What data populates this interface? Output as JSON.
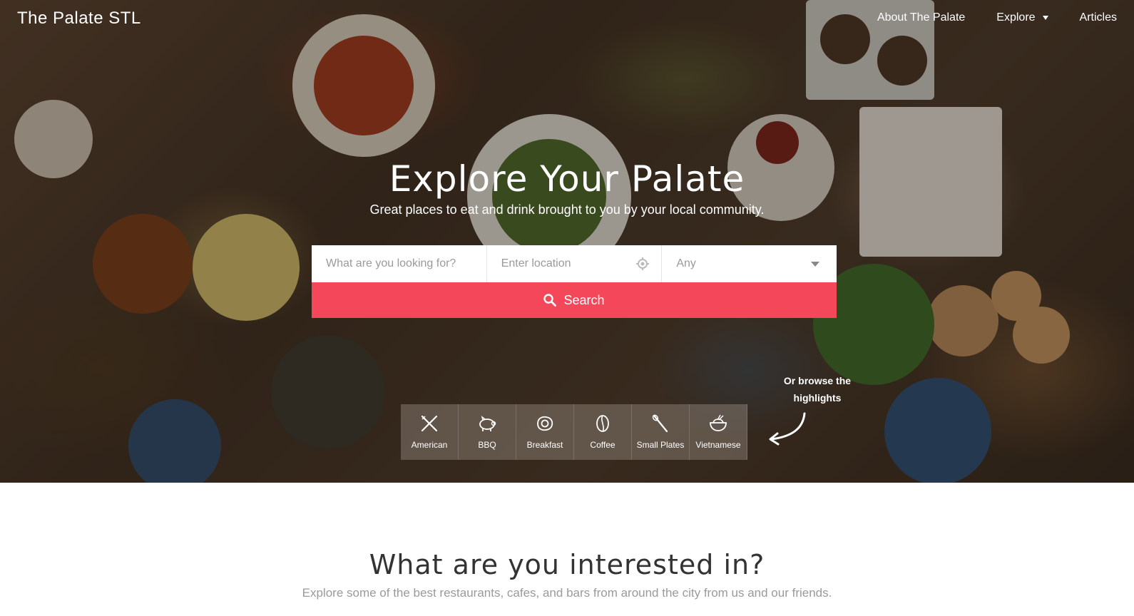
{
  "header": {
    "logo": "The Palate STL",
    "nav": [
      {
        "label": "About The Palate"
      },
      {
        "label": "Explore"
      },
      {
        "label": "Articles"
      }
    ]
  },
  "hero": {
    "title": "Explore Your Palate",
    "subtitle": "Great places to eat and drink brought to you by your local community."
  },
  "search": {
    "keyword_placeholder": "What are you looking for?",
    "location_placeholder": "Enter location",
    "category_value": "Any",
    "button_label": "Search"
  },
  "categories": [
    {
      "label": "American",
      "icon": "fork-knife-icon"
    },
    {
      "label": "BBQ",
      "icon": "pig-icon"
    },
    {
      "label": "Breakfast",
      "icon": "egg-icon"
    },
    {
      "label": "Coffee",
      "icon": "coffee-bean-icon"
    },
    {
      "label": "Small Plates",
      "icon": "spoon-fork-icon"
    },
    {
      "label": "Vietnamese",
      "icon": "rice-bowl-icon"
    }
  ],
  "browse_hint": "Or browse the highlights",
  "section": {
    "title": "What are you interested in?",
    "subtitle": "Explore some of the best restaurants, cafes, and bars from around the city from us and our friends."
  },
  "colors": {
    "accent": "#f5475a"
  }
}
